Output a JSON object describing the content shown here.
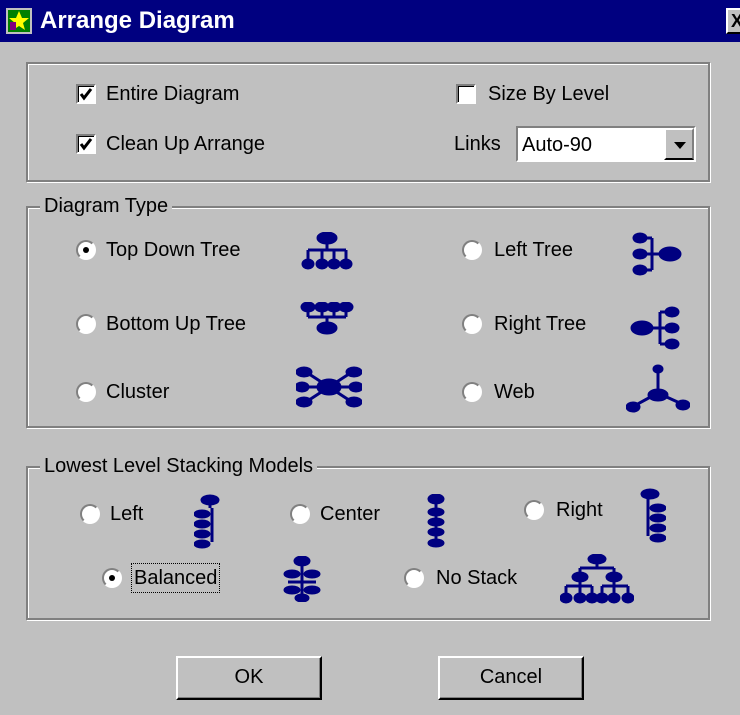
{
  "window": {
    "title": "Arrange Diagram",
    "close_label": "X"
  },
  "options": {
    "entire_diagram": {
      "label": "Entire Diagram",
      "checked": true
    },
    "clean_up_arrange": {
      "label": "Clean Up Arrange",
      "checked": true
    },
    "size_by_level": {
      "label": "Size By Level",
      "checked": false
    },
    "links_label": "Links",
    "links_value": "Auto-90"
  },
  "diagram_type": {
    "legend": "Diagram Type",
    "items": [
      {
        "label": "Top Down Tree",
        "selected": true,
        "icon": "top-down-tree-icon"
      },
      {
        "label": "Left Tree",
        "selected": false,
        "icon": "left-tree-icon"
      },
      {
        "label": "Bottom Up Tree",
        "selected": false,
        "icon": "bottom-up-tree-icon"
      },
      {
        "label": "Right Tree",
        "selected": false,
        "icon": "right-tree-icon"
      },
      {
        "label": "Cluster",
        "selected": false,
        "icon": "cluster-icon"
      },
      {
        "label": "Web",
        "selected": false,
        "icon": "web-icon"
      }
    ]
  },
  "stacking": {
    "legend": "Lowest Level Stacking Models",
    "items": [
      {
        "label": "Left",
        "selected": false,
        "icon": "left-stack-icon"
      },
      {
        "label": "Center",
        "selected": false,
        "icon": "center-stack-icon"
      },
      {
        "label": "Right",
        "selected": false,
        "icon": "right-stack-icon"
      },
      {
        "label": "Balanced",
        "selected": true,
        "icon": "balanced-stack-icon"
      },
      {
        "label": "No Stack",
        "selected": false,
        "icon": "no-stack-icon"
      }
    ]
  },
  "buttons": {
    "ok": "OK",
    "cancel": "Cancel"
  },
  "colors": {
    "titlebar": "#000080",
    "face": "#c0c0c0",
    "icon": "#000080"
  }
}
